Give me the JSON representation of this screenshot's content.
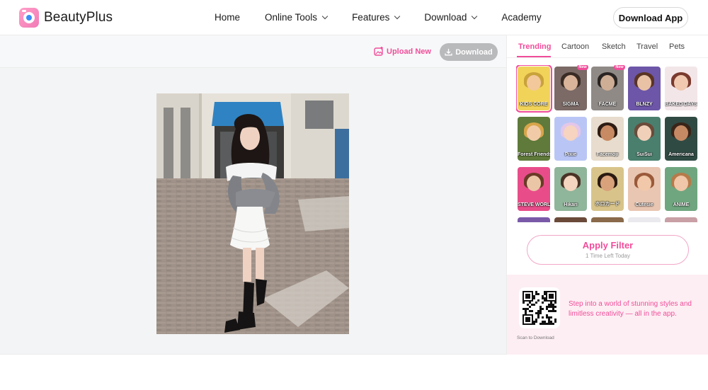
{
  "brand": {
    "name": "BeautyPlus",
    "accent_color": "#f04d9a",
    "logo_icon": "camera-lens-icon"
  },
  "header": {
    "nav": [
      {
        "label": "Home",
        "has_dropdown": false
      },
      {
        "label": "Online Tools",
        "has_dropdown": true
      },
      {
        "label": "Features",
        "has_dropdown": true
      },
      {
        "label": "Download",
        "has_dropdown": true
      },
      {
        "label": "Academy",
        "has_dropdown": false
      }
    ],
    "cta_label": "Download App"
  },
  "toolbar": {
    "upload_label": "Upload New",
    "upload_icon": "image-upload-icon",
    "download_label": "Download",
    "download_icon": "download-icon",
    "download_enabled": false
  },
  "editor": {
    "photo_subject": "woman-street-photo"
  },
  "filters": {
    "tabs": [
      "Trending",
      "Cartoon",
      "Sketch",
      "Travel",
      "Pets"
    ],
    "active_tab": "Trending",
    "new_badge_label": "New",
    "items": [
      {
        "label": "KIDS CORE",
        "selected": true,
        "is_new": false,
        "bg": "#f2d35a",
        "face": "#f3c89a",
        "hair": "#c9a23a"
      },
      {
        "label": "SIGMA",
        "selected": false,
        "is_new": true,
        "bg": "#7b6a66",
        "face": "#d9b49a",
        "hair": "#3a2b24"
      },
      {
        "label": "FACME",
        "selected": false,
        "is_new": true,
        "bg": "#8f8a86",
        "face": "#cfae96",
        "hair": "#2a2522"
      },
      {
        "label": "BLNZY",
        "selected": false,
        "is_new": false,
        "bg": "#6d56a8",
        "face": "#e9c2a6",
        "hair": "#5a3424"
      },
      {
        "label": "BAKED DAYS",
        "selected": false,
        "is_new": false,
        "bg": "#f3e6e9",
        "face": "#f0c9b0",
        "hair": "#7a3a2e"
      },
      {
        "label": "Forest Friends",
        "selected": false,
        "is_new": false,
        "bg": "#5f7a3a",
        "face": "#f1cba8",
        "hair": "#d7a54a"
      },
      {
        "label": "Pixie",
        "selected": false,
        "is_new": false,
        "bg": "#b9c6f5",
        "face": "#f6d4c0",
        "hair": "#e3c6e9"
      },
      {
        "label": "Facemoji",
        "selected": false,
        "is_new": false,
        "bg": "#e7dccd",
        "face": "#c88a62",
        "hair": "#2d1c14"
      },
      {
        "label": "SuiSui",
        "selected": false,
        "is_new": false,
        "bg": "#4a7f6e",
        "face": "#f0d0b8",
        "hair": "#6b4b3a"
      },
      {
        "label": "Americana",
        "selected": false,
        "is_new": false,
        "bg": "#2f4a43",
        "face": "#c58a64",
        "hair": "#3a2418"
      },
      {
        "label": "STEVE WORLD",
        "selected": false,
        "is_new": false,
        "bg": "#e84d8a",
        "face": "#eac6a7",
        "hair": "#6a3a26"
      },
      {
        "label": "Hikari",
        "selected": false,
        "is_new": false,
        "bg": "#8fb59a",
        "face": "#f4d5bf",
        "hair": "#4a3326"
      },
      {
        "label": "ホロカード",
        "selected": false,
        "is_new": false,
        "bg": "#d8c48a",
        "face": "#d9a27a",
        "hair": "#2b1a12"
      },
      {
        "label": "Cutesie",
        "selected": false,
        "is_new": false,
        "bg": "#e9c6b2",
        "face": "#f1c9aa",
        "hair": "#9a5a3a"
      },
      {
        "label": "ANIME",
        "selected": false,
        "is_new": false,
        "bg": "#6fa67f",
        "face": "#f0c7a8",
        "hair": "#b77a4a"
      }
    ]
  },
  "apply": {
    "label": "Apply Filter",
    "sublabel": "1 Time Left Today"
  },
  "promo": {
    "text": "Step into a world of stunning styles and limitless creativity — all in the app.",
    "scan_label": "Scan to Download",
    "qr_icon": "qr-code-icon"
  }
}
